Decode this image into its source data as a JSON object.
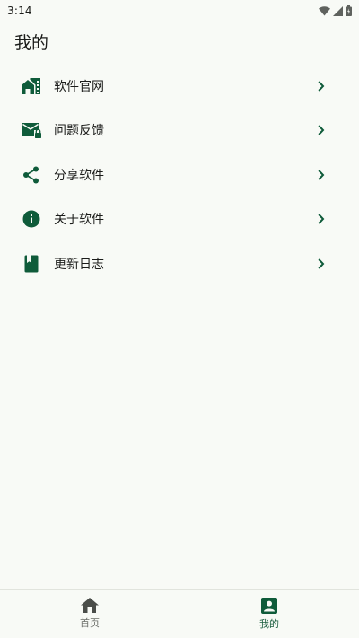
{
  "status_bar": {
    "time": "3:14",
    "icons": [
      "wifi-icon",
      "cellular-signal-icon",
      "battery-icon"
    ]
  },
  "page": {
    "title": "我的"
  },
  "colors": {
    "accent": "#0f5b3a",
    "background": "#f8faf6",
    "text": "#1b1c1a",
    "inactive": "#6b6e69"
  },
  "menu": {
    "items": [
      {
        "label": "软件官网",
        "icon": "home-web-icon"
      },
      {
        "label": "问题反馈",
        "icon": "mail-lock-icon"
      },
      {
        "label": "分享软件",
        "icon": "share-icon"
      },
      {
        "label": "关于软件",
        "icon": "info-icon"
      },
      {
        "label": "更新日志",
        "icon": "book-icon"
      }
    ],
    "chevron_icon": "chevron-right-icon"
  },
  "bottom_nav": {
    "tabs": [
      {
        "label": "首页",
        "icon": "home-icon",
        "active": false
      },
      {
        "label": "我的",
        "icon": "account-box-icon",
        "active": true
      }
    ]
  }
}
